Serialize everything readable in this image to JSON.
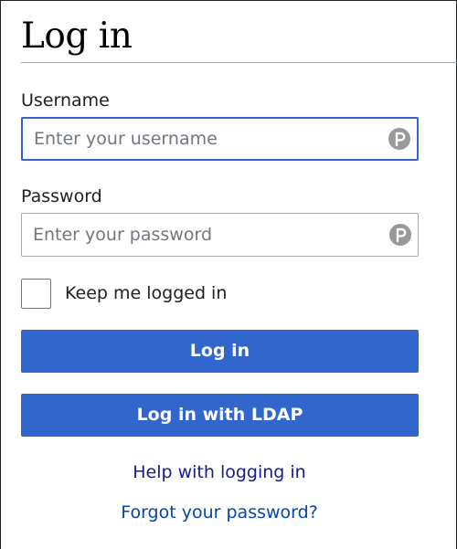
{
  "page": {
    "title": "Log in"
  },
  "form": {
    "username": {
      "label": "Username",
      "placeholder": "Enter your username",
      "value": ""
    },
    "password": {
      "label": "Password",
      "placeholder": "Enter your password",
      "value": ""
    },
    "remember": {
      "label": "Keep me logged in",
      "checked": false
    },
    "login_button": "Log in",
    "ldap_button": "Log in with LDAP"
  },
  "links": {
    "help": "Help with logging in",
    "forgot": "Forgot your password?"
  },
  "icons": {
    "password_manager": "password-manager-icon"
  },
  "colors": {
    "accent": "#3366cc",
    "text": "#202122",
    "placeholder": "#72777d",
    "border": "#a2a9b1",
    "help_link": "#1a1a8c",
    "forgot_link": "#0645ad",
    "icon": "#999999"
  }
}
